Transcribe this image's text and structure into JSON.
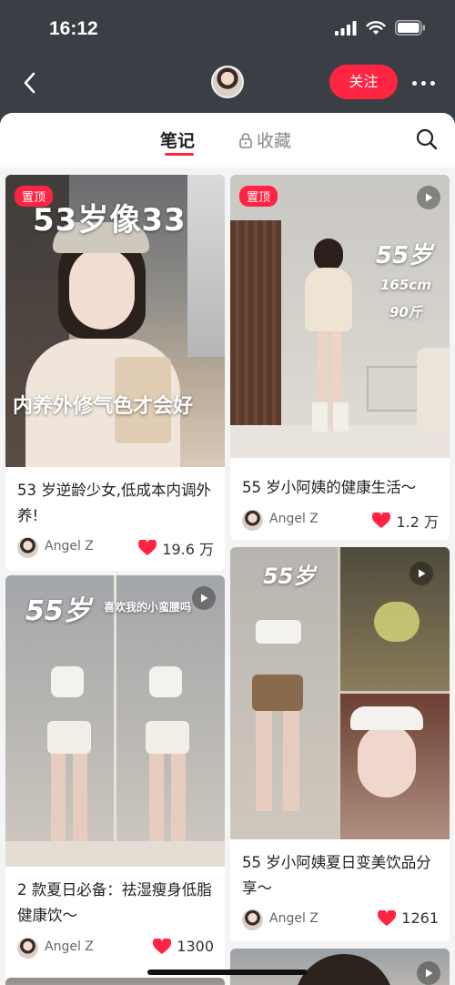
{
  "status": {
    "time": "16:12"
  },
  "header": {
    "follow_label": "关注"
  },
  "tabs": {
    "notes": "笔记",
    "favorites": "收藏"
  },
  "colors": {
    "accent": "#ff2442",
    "header_bg": "#3a3f45",
    "like_heart": "#ff2442"
  },
  "icons": [
    "back-icon",
    "more-icon",
    "lock-icon",
    "search-icon",
    "play-icon",
    "heart-icon",
    "signal-icon",
    "wifi-icon",
    "battery-icon"
  ],
  "cards": [
    {
      "pin": "置顶",
      "overlay_top": "53岁像33",
      "overlay_mid": "内养外修气色才会好",
      "title": "53 岁逆龄少女,低成本内调外养!",
      "author": "Angel Z",
      "likes": "19.6 万"
    },
    {
      "pin": "置顶",
      "overlay_top": "55岁",
      "overlay_l2": "165cm",
      "overlay_l3": "90斤",
      "title": "55 岁小阿姨的健康生活～",
      "author": "Angel Z",
      "likes": "1.2 万"
    },
    {
      "overlay_top": "55岁",
      "overlay_sub": "喜欢我的小蛮腰吗",
      "title": "2 款夏日必备：祛湿瘦身低脂健康饮～",
      "author": "Angel Z",
      "likes": "1300"
    },
    {
      "overlay_top": "55岁",
      "title": "55 岁小阿姨夏日变美饮品分享～",
      "author": "Angel Z",
      "likes": "1261"
    }
  ]
}
